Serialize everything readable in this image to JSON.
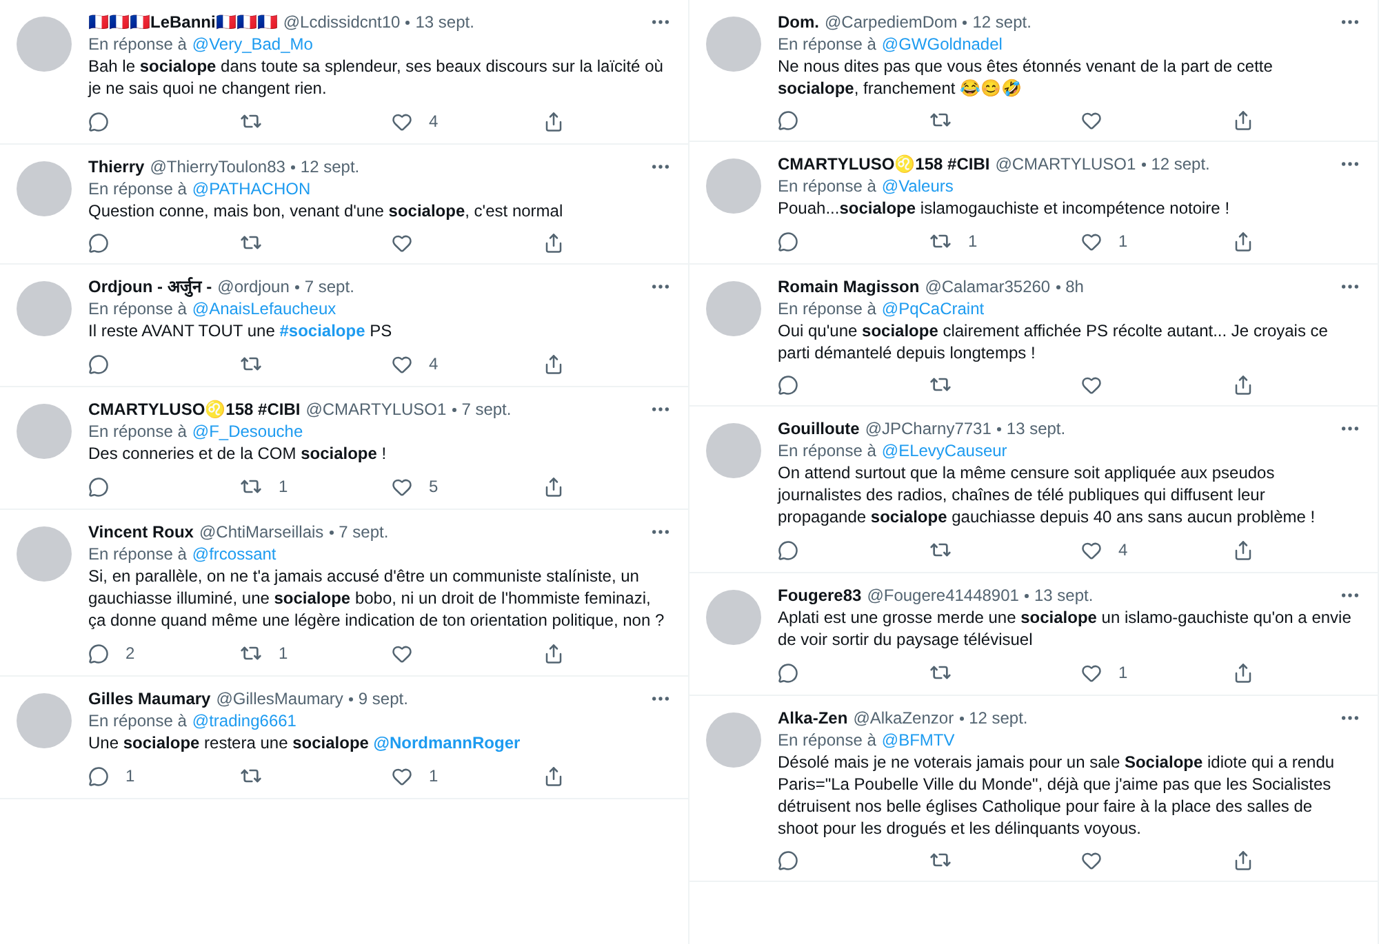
{
  "columns": [
    {
      "tweets": [
        {
          "name": "🇫🇷🇫🇷🇫🇷LeBanni🇫🇷🇫🇷🇫🇷",
          "handle": "@Lcdissidcnt10",
          "date": "13 sept.",
          "reply": {
            "label": "En réponse à",
            "handle": "@Very_Bad_Mo"
          },
          "body": [
            {
              "kind": "text",
              "text": "Bah le **socialope** dans toute sa splendeur, ses beaux discours sur la laïcité où je ne sais quoi ne changent rien."
            }
          ],
          "likes": "4"
        },
        {
          "name": "Thierry",
          "handle": "@ThierryToulon83",
          "date": "12 sept.",
          "reply": {
            "label": "En réponse à",
            "handle": "@PATHACHON"
          },
          "body": [
            {
              "kind": "text",
              "text": "Question conne, mais bon, venant d'une **socialope**, c'est normal"
            }
          ]
        },
        {
          "name": "Ordjoun - अर्जुन -",
          "handle": "@ordjoun",
          "date": "7 sept.",
          "reply": {
            "label": "En réponse à",
            "handle": "@AnaisLefaucheux"
          },
          "body": [
            {
              "kind": "text",
              "text": "Il reste AVANT TOUT une "
            },
            {
              "kind": "link",
              "text": "#socialope"
            },
            {
              "kind": "text",
              "text": " PS"
            }
          ],
          "likes": "4"
        },
        {
          "name": "CMARTYLUSO♌158 #CIBI",
          "handle": "@CMARTYLUSO1",
          "date": "7 sept.",
          "reply": {
            "label": "En réponse à",
            "handle": "@F_Desouche"
          },
          "body": [
            {
              "kind": "text",
              "text": "Des conneries et de la COM **socialope** !"
            }
          ],
          "retweets": "1",
          "likes": "5"
        },
        {
          "name": "Vincent Roux",
          "handle": "@ChtiMarseillais",
          "date": "7 sept.",
          "reply": {
            "label": "En réponse à",
            "handle": "@frcossant"
          },
          "body": [
            {
              "kind": "text",
              "text": "Si, en parallèle, on ne t'a jamais accusé d'être un communiste stalíniste, un gauchiasse illuminé, une **socialope** bobo, ni un droit de l'hommiste feminazi, ça donne quand même une légère indication de ton orientation politique, non ?"
            }
          ],
          "replies": "2",
          "retweets": "1"
        },
        {
          "name": "Gilles Maumary",
          "handle": "@GillesMaumary",
          "date": "9 sept.",
          "reply": {
            "label": "En réponse à",
            "handle": "@trading6661"
          },
          "body": [
            {
              "kind": "text",
              "text": "Une **socialope** restera une **socialope** "
            },
            {
              "kind": "link",
              "text": "@NordmannRoger"
            }
          ],
          "replies": "1",
          "likes": "1"
        }
      ]
    },
    {
      "tweets": [
        {
          "name": "Dom.",
          "handle": "@CarpediemDom",
          "date": "12 sept.",
          "reply": {
            "label": "En réponse à",
            "handle": "@GWGoldnadel"
          },
          "body": [
            {
              "kind": "text",
              "text": "Ne nous dites pas que vous êtes étonnés venant de la part de cette **socialope**, franchement 😂😊🤣"
            }
          ]
        },
        {
          "name": "CMARTYLUSO♌158 #CIBI",
          "handle": "@CMARTYLUSO1",
          "date": "12 sept.",
          "reply": {
            "label": "En réponse à",
            "handle": "@Valeurs"
          },
          "body": [
            {
              "kind": "text",
              "text": "Pouah...**socialope** islamogauchiste et incompétence notoire !"
            }
          ],
          "retweets": "1",
          "likes": "1"
        },
        {
          "name": "Romain Magisson",
          "handle": "@Calamar35260",
          "date": "8h",
          "reply": {
            "label": "En réponse à",
            "handle": "@PqCaCraint"
          },
          "body": [
            {
              "kind": "text",
              "text": "Oui qu'une **socialope** clairement affichée PS récolte autant... Je croyais ce parti démantelé depuis longtemps !"
            }
          ]
        },
        {
          "name": "Gouilloute",
          "handle": "@JPCharny7731",
          "date": "13 sept.",
          "reply": {
            "label": "En réponse à",
            "handle": "@ELevyCauseur"
          },
          "body": [
            {
              "kind": "text",
              "text": "On attend surtout que la même censure soit appliquée aux pseudos journalistes des radios, chaînes de télé publiques qui diffusent leur propagande **socialope** gauchiasse depuis 40 ans sans aucun problème !"
            }
          ],
          "likes": "4"
        },
        {
          "name": "Fougere83",
          "handle": "@Fougere41448901",
          "date": "13 sept.",
          "body": [
            {
              "kind": "text",
              "text": "Aplati est une grosse merde une **socialope** un islamo-gauchiste qu'on a envie de voir sortir du paysage télévisuel"
            }
          ],
          "likes": "1"
        },
        {
          "name": "Alka-Zen",
          "handle": "@AlkaZenzor",
          "date": "12 sept.",
          "reply": {
            "label": "En réponse à",
            "handle": "@BFMTV"
          },
          "body": [
            {
              "kind": "text",
              "text": "Désolé mais je ne voterais jamais pour un sale **Socialope** idiote qui a rendu Paris=\"La Poubelle Ville du Monde\", déjà que j'aime pas que les Socialistes détruisent nos belle églises Catholique pour faire à la place des salles de shoot pour les drogués et les délinquants voyous."
            }
          ]
        }
      ]
    }
  ]
}
